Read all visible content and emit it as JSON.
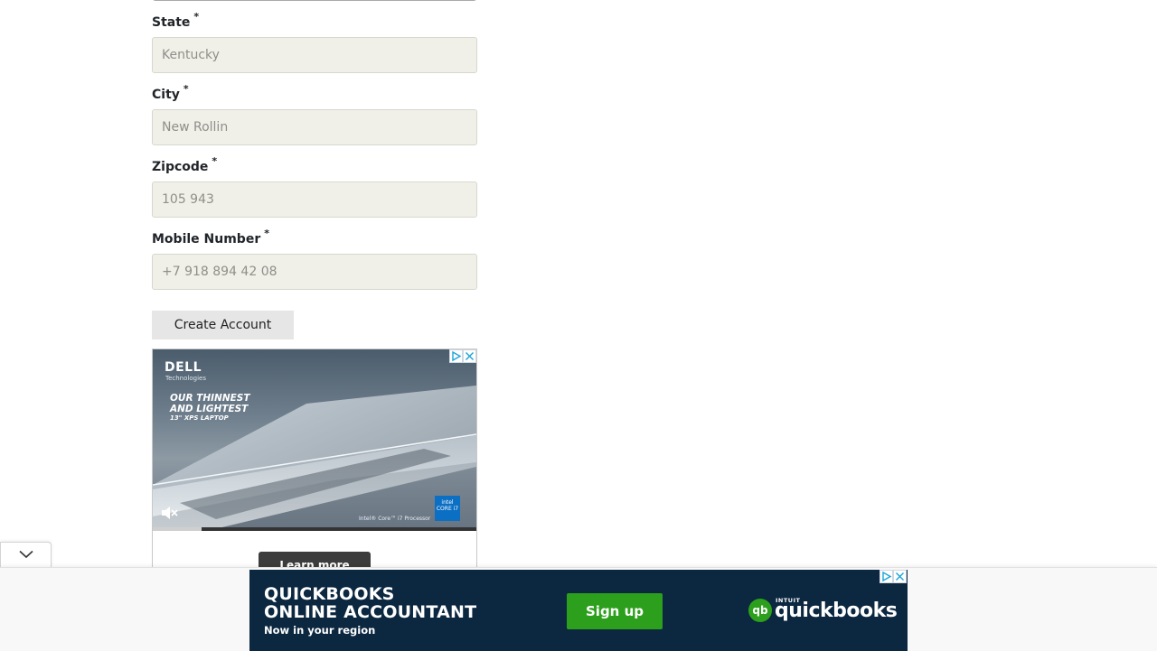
{
  "form": {
    "state": {
      "label": "State",
      "required_mark": "*",
      "placeholder": "Kentucky"
    },
    "city": {
      "label": "City",
      "required_mark": "*",
      "placeholder": "New Rollin"
    },
    "zipcode": {
      "label": "Zipcode",
      "required_mark": "*",
      "placeholder": "105 943"
    },
    "mobile": {
      "label": "Mobile Number",
      "required_mark": "*",
      "placeholder": "+7 918 894 42 08"
    },
    "submit_label": "Create Account"
  },
  "dell_ad": {
    "brand": "DELL",
    "brand_sub": "Technologies",
    "headline_line1": "OUR THINNEST",
    "headline_line2": "AND LIGHTEST",
    "headline_line3": "13\" XPS LAPTOP",
    "processor_text": "Intel® Core™ i7 Processor",
    "intel_badge": "intel CORE i7",
    "cta_label": "Learn more",
    "video_progress": 0.15,
    "mute_icon": "muted-speaker-icon"
  },
  "collapse_handle": {
    "icon": "chevron-down-icon"
  },
  "footer_ad": {
    "title_line1": "QUICKBOOKS",
    "title_line2": "ONLINE ACCOUNTANT",
    "subtitle": "Now in your region",
    "cta_label": "Sign up",
    "logo_prefix": "INTUIT",
    "logo_text": "quickbooks",
    "logo_mark": "qb"
  },
  "colors": {
    "input_bg": "#f0f0e8",
    "button_bg": "#e6e6e6",
    "qb_bg": "#0c2740",
    "qb_green": "#2ca01c",
    "intel_blue": "#0b6fc4"
  }
}
